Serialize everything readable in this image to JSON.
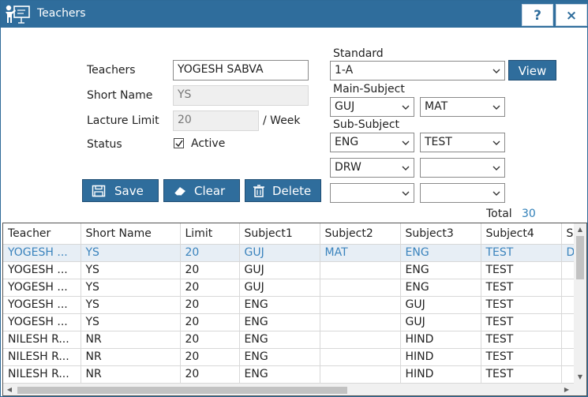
{
  "window": {
    "title": "Teachers",
    "help_label": "?",
    "close_label": "×"
  },
  "form": {
    "teachers_label": "Teachers",
    "teachers_value": "YOGESH SABVA",
    "short_name_label": "Short Name",
    "short_name_value": "YS",
    "lecture_limit_label": "Lacture Limit",
    "lecture_limit_value": "20",
    "per_week_label": "/ Week",
    "status_label": "Status",
    "active_label": "Active",
    "active_checked": true
  },
  "standard": {
    "label": "Standard",
    "value": "1-A",
    "view_label": "View"
  },
  "main_subject": {
    "label": "Main-Subject",
    "values": [
      "GUJ",
      "MAT"
    ]
  },
  "sub_subject": {
    "label": "Sub-Subject",
    "values": [
      "ENG",
      "TEST",
      "DRW",
      "",
      "",
      ""
    ]
  },
  "actions": {
    "save_label": "Save",
    "clear_label": "Clear",
    "delete_label": "Delete"
  },
  "total": {
    "label": "Total",
    "value": "30"
  },
  "table": {
    "columns": [
      "Teacher",
      "Short Name",
      "Limit",
      "Subject1",
      "Subject2",
      "Subject3",
      "Subject4",
      "S"
    ],
    "rows": [
      [
        "YOGESH ...",
        "YS",
        "20",
        "GUJ",
        "MAT",
        "ENG",
        "TEST",
        "D"
      ],
      [
        "YOGESH ...",
        "YS",
        "20",
        "GUJ",
        "",
        "ENG",
        "TEST",
        ""
      ],
      [
        "YOGESH ...",
        "YS",
        "20",
        "GUJ",
        "",
        "ENG",
        "TEST",
        ""
      ],
      [
        "YOGESH ...",
        "YS",
        "20",
        "ENG",
        "",
        "GUJ",
        "TEST",
        ""
      ],
      [
        "YOGESH ...",
        "YS",
        "20",
        "ENG",
        "",
        "GUJ",
        "TEST",
        ""
      ],
      [
        "NILESH R...",
        "NR",
        "20",
        "ENG",
        "",
        "HIND",
        "TEST",
        ""
      ],
      [
        "NILESH R...",
        "NR",
        "20",
        "ENG",
        "",
        "HIND",
        "TEST",
        ""
      ],
      [
        "NILESH R...",
        "NR",
        "20",
        "ENG",
        "",
        "HIND",
        "TEST",
        ""
      ]
    ],
    "selected_row": 0
  },
  "colors": {
    "accent": "#2f6d9c",
    "selected_text": "#3a83bd"
  }
}
